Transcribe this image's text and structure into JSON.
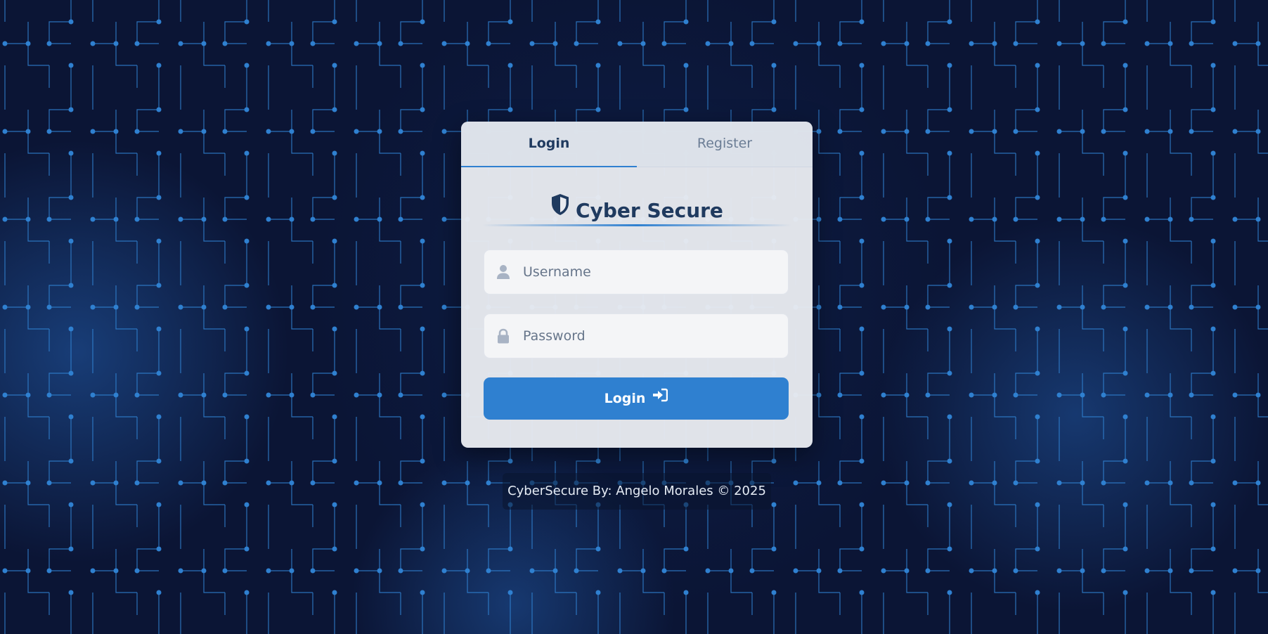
{
  "tabs": {
    "login": "Login",
    "register": "Register"
  },
  "brand": {
    "title": "Cyber Secure",
    "icon": "shield-icon"
  },
  "form": {
    "username_placeholder": "Username",
    "username_value": "",
    "username_icon": "user-icon",
    "password_placeholder": "Password",
    "password_value": "",
    "password_icon": "lock-icon",
    "submit_label": "Login",
    "submit_icon": "sign-in-icon"
  },
  "footer": {
    "text": "CyberSecure By: Angelo Morales © 2025"
  },
  "colors": {
    "background": "#0b1535",
    "circuit": "#2f80d0",
    "accent": "#2f80d0",
    "card": "#e9ebf0",
    "brand_text": "#1f3a5f"
  }
}
